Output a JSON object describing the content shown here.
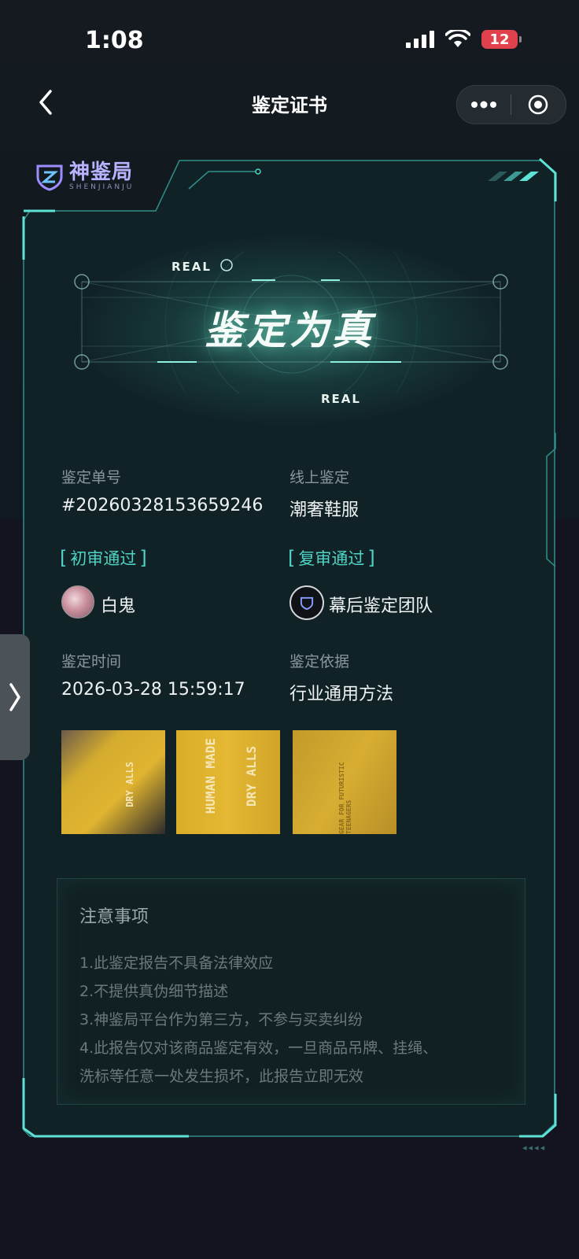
{
  "status_bar": {
    "time": "1:08",
    "battery": "12"
  },
  "nav": {
    "title": "鉴定证书"
  },
  "logo": {
    "name": "神鉴局",
    "sub": "SHENJIANJU"
  },
  "hero": {
    "title": "鉴定为真",
    "badge_top": "REAL",
    "badge_bottom": "REAL"
  },
  "details": {
    "order_no_label": "鉴定单号",
    "order_no": "#20260328153659246",
    "category_label": "线上鉴定",
    "category": "潮奢鞋服",
    "first_review_tag": "初审通过",
    "first_reviewer": "白鬼",
    "second_review_tag": "复审通过",
    "second_reviewer": "幕后鉴定团队",
    "time_label": "鉴定时间",
    "time": "2026-03-28 15:59:17",
    "basis_label": "鉴定依据",
    "basis": "行业通用方法"
  },
  "photos": [
    {
      "text": "DRY ALLS"
    },
    {
      "text_a": "HUMAN MADE",
      "text_b": "DRY ALLS"
    },
    {
      "text": "GEAR FOR FUTURISTIC TEENAGERS"
    }
  ],
  "notice": {
    "title": "注意事项",
    "items": [
      "1.此鉴定报告不具备法律效应",
      "2.不提供真伪细节描述",
      "3.神鉴局平台作为第三方，不参与买卖纠纷",
      "4.此报告仅对该商品鉴定有效，一旦商品吊牌、挂绳、",
      "洗标等任意一处发生损坏，此报告立即无效"
    ]
  },
  "colors": {
    "accent": "#4fd3c4",
    "frame": "#39c9c0",
    "background": "#12161f"
  }
}
